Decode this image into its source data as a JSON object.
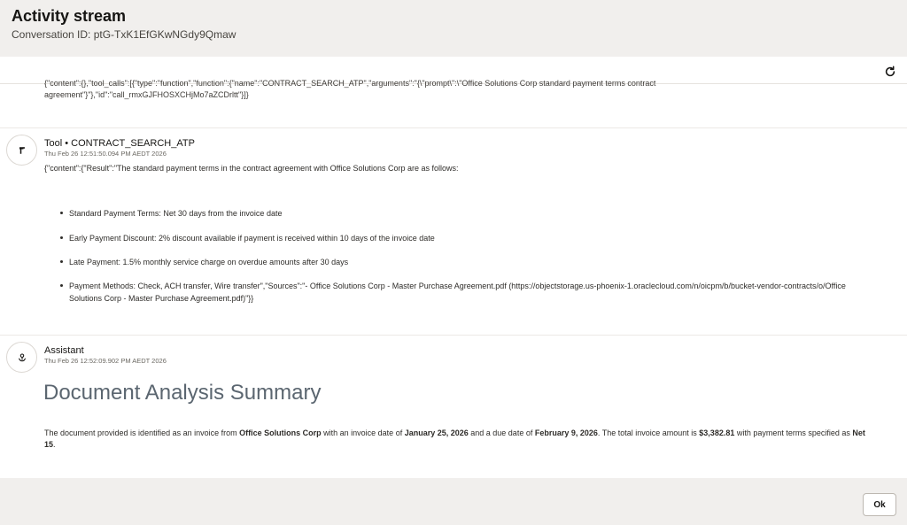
{
  "header": {
    "title": "Activity stream",
    "conversation_label": "Conversation ID: ptG-TxK1EfGKwNGdy9Qmaw"
  },
  "icons": {
    "refresh": "refresh-icon",
    "tool": "wrench-icon",
    "assistant": "assistant-icon"
  },
  "stream": {
    "truncated_line1": "{\"content\":{},\"tool_calls\":[{\"type\":\"function\",\"function\":{\"name\":\"CONTRACT_SEARCH_ATP\",\"arguments\":\"{\\\"prompt\\\":\\\"Office Solutions Corp standard payment terms contract",
    "truncated_line2": "agreement\"}\"},\"id\":\"call_rmxGJFHOSXCHjMo7aZCDrltt\"}]}",
    "tool_message": {
      "name": "Tool • CONTRACT_SEARCH_ATP",
      "time": "Thu Feb 26 12:51:50.094 PM AEDT 2026",
      "intro": "{\"content\":{\"Result\":\"The standard payment terms in the contract agreement with Office Solutions Corp are as follows:",
      "bullets": [
        "Standard Payment Terms: Net 30 days from the invoice date",
        "Early Payment Discount: 2% discount available if payment is received within 10 days of the invoice date",
        "Late Payment: 1.5% monthly service charge on overdue amounts after 30 days",
        "Payment Methods: Check, ACH transfer, Wire transfer\",\"Sources\":\"- Office Solutions Corp - Master Purchase Agreement.pdf (https://objectstorage.us-phoenix-1.oraclecloud.com/n/oicpm/b/bucket-vendor-contracts/o/Office Solutions Corp - Master Purchase Agreement.pdf)\"}}"
      ]
    },
    "assistant_message": {
      "name": "Assistant",
      "time": "Thu Feb 26 12:52:09.902 PM AEDT 2026",
      "heading": "Document Analysis Summary",
      "summary": {
        "p1": "The document provided is identified as an invoice from ",
        "vendor": "Office Solutions Corp",
        "p2": " with an invoice date of ",
        "invoice_date": "January 25, 2026",
        "p3": " and a due date of ",
        "due_date": "February 9, 2026",
        "p4": ". The total invoice amount is ",
        "amount": "$3,382.81",
        "p5": " with payment terms specified as ",
        "terms": "Net 15",
        "p6": "."
      }
    }
  },
  "footer": {
    "ok_label": "Ok"
  }
}
